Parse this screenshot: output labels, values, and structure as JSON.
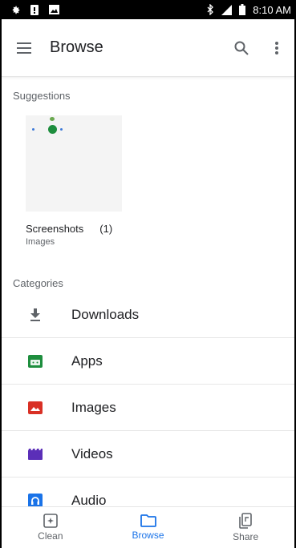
{
  "status_bar": {
    "time": "8:10 AM",
    "icons": [
      "settings-icon",
      "notification-icon",
      "gallery-icon",
      "bluetooth-icon",
      "signal-icon",
      "battery-icon"
    ]
  },
  "app_bar": {
    "title": "Browse",
    "icons": [
      "menu-icon",
      "search-icon",
      "more-vert-icon"
    ]
  },
  "suggestions": {
    "label": "Suggestions",
    "items": [
      {
        "title": "Screenshots",
        "count": "(1)",
        "subtitle": "Images"
      }
    ]
  },
  "categories": {
    "label": "Categories",
    "items": [
      {
        "label": "Downloads",
        "icon": "download-icon",
        "color": "#5f6368"
      },
      {
        "label": "Apps",
        "icon": "android-app-icon",
        "color": "#1e8e3e"
      },
      {
        "label": "Images",
        "icon": "image-icon",
        "color": "#d93025"
      },
      {
        "label": "Videos",
        "icon": "video-icon",
        "color": "#5b2fb8"
      },
      {
        "label": "Audio",
        "icon": "audio-icon",
        "color": "#1a73e8"
      }
    ]
  },
  "bottom_nav": {
    "items": [
      {
        "label": "Clean",
        "icon": "clean-icon",
        "active": false
      },
      {
        "label": "Browse",
        "icon": "folder-icon",
        "active": true
      },
      {
        "label": "Share",
        "icon": "share-icon",
        "active": false
      }
    ]
  },
  "colors": {
    "accent": "#1a73e8",
    "text": "#202124",
    "secondary": "#5f6368",
    "divider": "#e6e6e6"
  }
}
